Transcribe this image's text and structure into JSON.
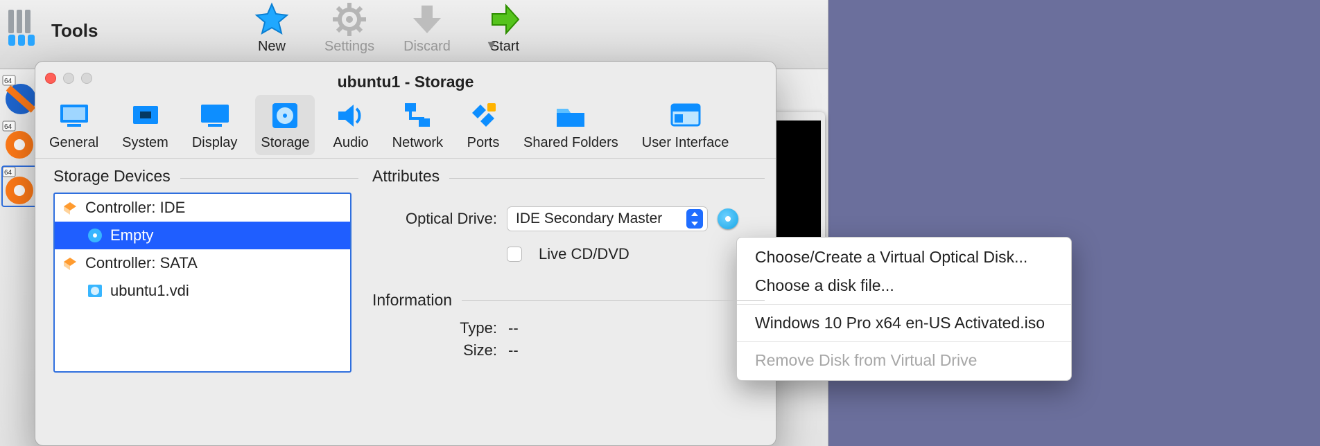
{
  "mainToolbar": {
    "toolsLabel": "Tools",
    "actions": {
      "new": "New",
      "settings": "Settings",
      "discard": "Discard",
      "start": "Start"
    }
  },
  "sheet": {
    "title": "ubuntu1 - Storage",
    "tabs": {
      "general": "General",
      "system": "System",
      "display": "Display",
      "storage": "Storage",
      "audio": "Audio",
      "network": "Network",
      "ports": "Ports",
      "shared": "Shared Folders",
      "ui": "User Interface"
    },
    "devices": {
      "heading": "Storage Devices",
      "controllerIDE": "Controller: IDE",
      "empty": "Empty",
      "controllerSATA": "Controller: SATA",
      "vdi": "ubuntu1.vdi"
    },
    "attributes": {
      "heading": "Attributes",
      "opticalDriveLabel": "Optical Drive:",
      "opticalDriveValue": "IDE Secondary Master",
      "liveCDLabel": "Live CD/DVD"
    },
    "information": {
      "heading": "Information",
      "typeLabel": "Type:",
      "typeValue": "--",
      "sizeLabel": "Size:",
      "sizeValue": "--"
    }
  },
  "contextMenu": {
    "chooseCreate": "Choose/Create a Virtual Optical Disk...",
    "chooseFile": "Choose a disk file...",
    "isoItem": "Windows 10 Pro x64 en-US Activated.iso",
    "removeDisk": "Remove Disk from Virtual Drive"
  }
}
